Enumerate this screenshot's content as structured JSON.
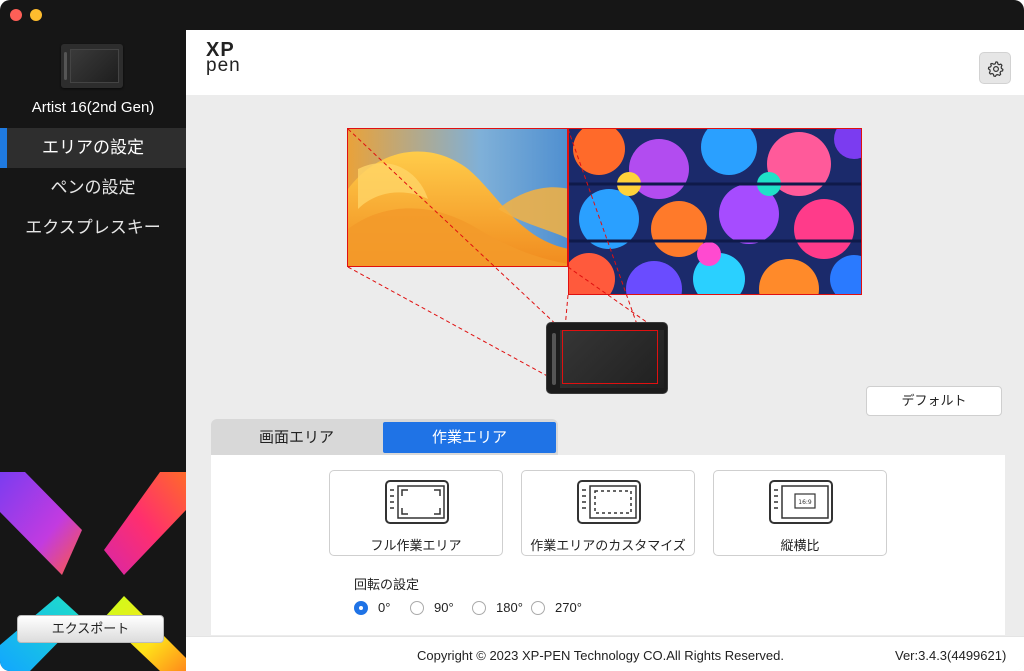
{
  "sidebar": {
    "device_name": "Artist 16(2nd Gen)",
    "items": [
      {
        "label": "エリアの設定",
        "active": true
      },
      {
        "label": "ペンの設定",
        "active": false
      },
      {
        "label": "エクスプレスキー",
        "active": false
      }
    ],
    "export_label": "エクスポート"
  },
  "header": {
    "logo_line1": "XP",
    "logo_line2": "pen",
    "settings_icon": "gear-icon"
  },
  "stage": {
    "default_label": "デフォルト"
  },
  "tabs": [
    {
      "label": "画面エリア",
      "active": false
    },
    {
      "label": "作業エリア",
      "active": true
    }
  ],
  "area_options": [
    {
      "label": "フル作業エリア",
      "icon": "full-area-icon"
    },
    {
      "label": "作業エリアのカスタマイズ",
      "icon": "custom-area-icon"
    },
    {
      "label": "縦横比",
      "icon": "aspect-ratio-icon",
      "icon_text": "16:9"
    }
  ],
  "rotation": {
    "title": "回転の設定",
    "options": [
      "0°",
      "90°",
      "180°",
      "270°"
    ],
    "selected": "0°"
  },
  "footer": {
    "copyright": "Copyright © 2023  XP-PEN Technology CO.All Rights Reserved.",
    "version": "Ver:3.4.3(4499621)"
  },
  "colors": {
    "accent": "#1f73e6",
    "mapping_red": "#e01010",
    "sidebar_bg": "#161616"
  }
}
